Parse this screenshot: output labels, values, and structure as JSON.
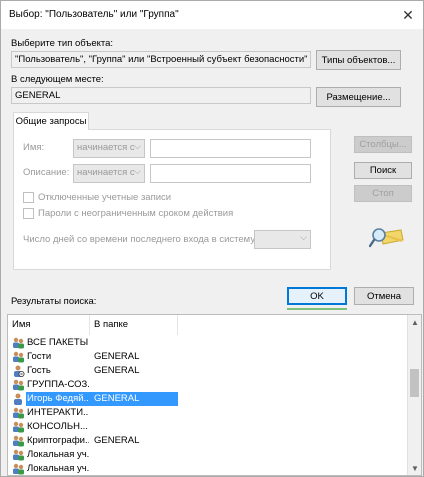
{
  "window": {
    "title": "Выбор: \"Пользователь\" или \"Группа\""
  },
  "object_type": {
    "label": "Выберите тип объекта:",
    "value": "\"Пользователь\", \"Группа\" или \"Встроенный субъект безопасности\"",
    "button": "Типы объектов..."
  },
  "location": {
    "label": "В следующем месте:",
    "value": "GENERAL",
    "button": "Размещение..."
  },
  "tab": {
    "label": "Общие запросы"
  },
  "query": {
    "name_label": "Имя:",
    "name_mode": "начинается с",
    "desc_label": "Описание:",
    "desc_mode": "начинается с",
    "disabled_accounts": "Отключенные учетные записи",
    "no_expire_passwords": "Пароли с неограниченным сроком действия",
    "days_label": "Число дней со времени последнего входа в систему:"
  },
  "side_buttons": {
    "columns": "Столбцы...",
    "search": "Поиск",
    "stop": "Стоп"
  },
  "actions": {
    "ok": "OK",
    "cancel": "Отмена"
  },
  "results": {
    "label": "Результаты поиска:",
    "col_name": "Имя",
    "col_folder": "В папке",
    "rows": [
      {
        "name": "ВСЕ ПАКЕТЫ...",
        "folder": "",
        "icon": "group-icon"
      },
      {
        "name": "Гости",
        "folder": "GENERAL",
        "icon": "group-icon"
      },
      {
        "name": "Гость",
        "folder": "GENERAL",
        "icon": "user-disabled-icon"
      },
      {
        "name": "ГРУППА-СОЗ...",
        "folder": "",
        "icon": "group-icon"
      },
      {
        "name": "Игорь Федяй...",
        "folder": "GENERAL",
        "icon": "user-icon",
        "selected": true
      },
      {
        "name": "ИНТЕРАКТИ...",
        "folder": "",
        "icon": "group-icon"
      },
      {
        "name": "КОНСОЛЬН...",
        "folder": "",
        "icon": "group-icon"
      },
      {
        "name": "Криптографи...",
        "folder": "GENERAL",
        "icon": "group-icon"
      },
      {
        "name": "Локальная уч...",
        "folder": "",
        "icon": "group-icon"
      },
      {
        "name": "Локальная уч...",
        "folder": "",
        "icon": "group-icon"
      }
    ]
  }
}
